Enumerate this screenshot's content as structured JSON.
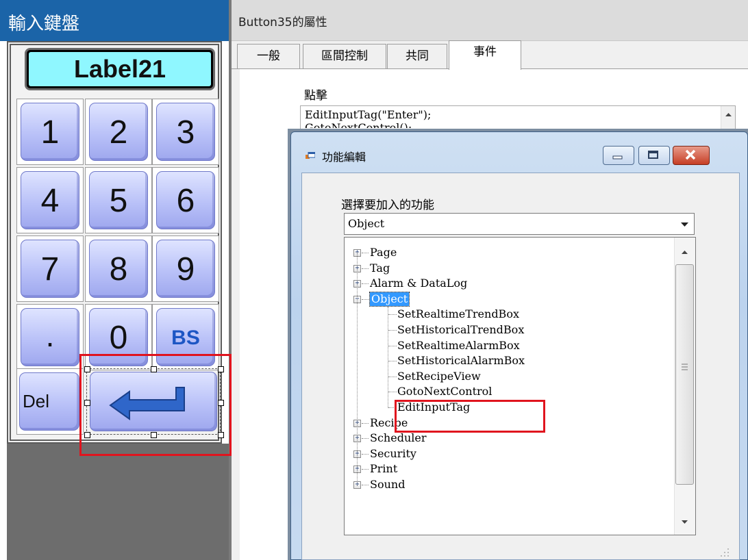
{
  "keypad": {
    "title": "輸入鍵盤",
    "label": "Label21",
    "rows": [
      [
        "1",
        "2",
        "3"
      ],
      [
        "4",
        "5",
        "6"
      ],
      [
        "7",
        "8",
        "9"
      ],
      [
        ".",
        "0",
        "BS"
      ]
    ],
    "del_label": "Del"
  },
  "properties": {
    "header": "Button35的屬性",
    "tabs": [
      "一般",
      "區間控制",
      "共同",
      "事件"
    ],
    "active_tab": "事件",
    "click_label": "點擊",
    "code_line1": "EditInputTag(\"Enter\");",
    "code_line2": "GotoNextControl();"
  },
  "dialog": {
    "title": "功能編輯",
    "choose_label": "選擇要加入的功能",
    "selected": "Object",
    "tree": {
      "top_items": [
        "Page",
        "Tag",
        "Alarm & DataLog"
      ],
      "expanded": "Object",
      "children": [
        "SetRealtimeTrendBox",
        "SetHistoricalTrendBox",
        "SetRealtimeAlarmBox",
        "SetHistoricalAlarmBox",
        "SetRecipeView",
        "GotoNextControl",
        "EditInputTag"
      ],
      "bottom_items": [
        "Recipe",
        "Scheduler",
        "Security",
        "Print",
        "Sound"
      ]
    }
  },
  "colors": {
    "highlight_red": "#e0141e",
    "keypad_title_blue": "#1b64a8",
    "label_cyan": "#8ff7ff",
    "tree_selection": "#3399ff"
  }
}
